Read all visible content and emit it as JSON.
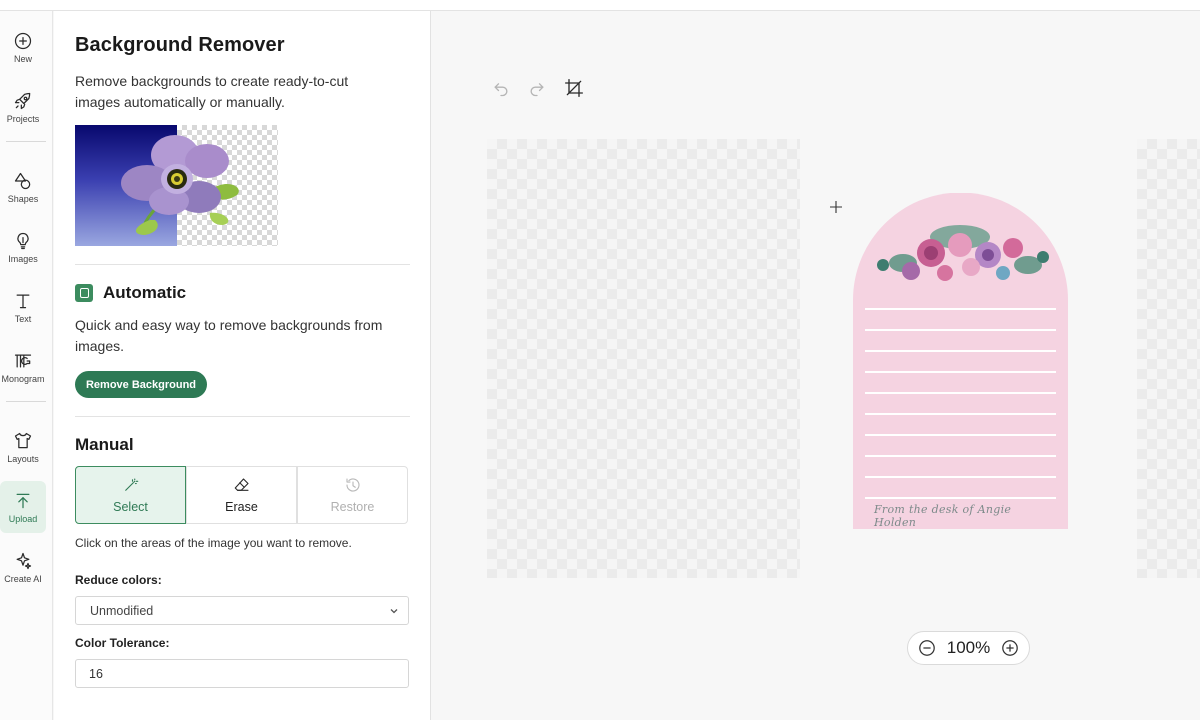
{
  "rail": {
    "items": [
      {
        "label": "New",
        "icon": "plus-circle-icon"
      },
      {
        "label": "Projects",
        "icon": "rocket-icon"
      },
      {
        "label": "Shapes",
        "icon": "shapes-icon"
      },
      {
        "label": "Images",
        "icon": "lightbulb-icon"
      },
      {
        "label": "Text",
        "icon": "text-icon"
      },
      {
        "label": "Monogram",
        "icon": "monogram-icon"
      },
      {
        "label": "Layouts",
        "icon": "shirt-icon"
      },
      {
        "label": "Upload",
        "icon": "upload-icon",
        "active": true
      },
      {
        "label": "Create AI",
        "icon": "sparkle-icon"
      }
    ]
  },
  "panel": {
    "title": "Background Remover",
    "description": "Remove backgrounds to create ready-to-cut images automatically or manually.",
    "automatic": {
      "title": "Automatic",
      "description": "Quick and easy way to remove backgrounds from images.",
      "button_label": "Remove Background"
    },
    "manual": {
      "title": "Manual",
      "tools": [
        {
          "label": "Select",
          "icon": "magic-wand-icon",
          "state": "selected"
        },
        {
          "label": "Erase",
          "icon": "eraser-icon",
          "state": "normal"
        },
        {
          "label": "Restore",
          "icon": "restore-history-icon",
          "state": "disabled"
        }
      ],
      "hint": "Click on the areas of the image you want to remove.",
      "reduce_colors_label": "Reduce colors:",
      "reduce_colors_value": "Unmodified",
      "color_tolerance_label": "Color Tolerance:",
      "color_tolerance_value": "16"
    }
  },
  "canvas": {
    "toolbar": {
      "undo": "undo-icon",
      "redo": "redo-icon",
      "crop": "crop-icon"
    },
    "card_signature": "From the desk of Angie Holden",
    "zoom": "100%"
  },
  "colors": {
    "accent_green": "#2e7a55",
    "card_pink": "#f5d3e1"
  }
}
